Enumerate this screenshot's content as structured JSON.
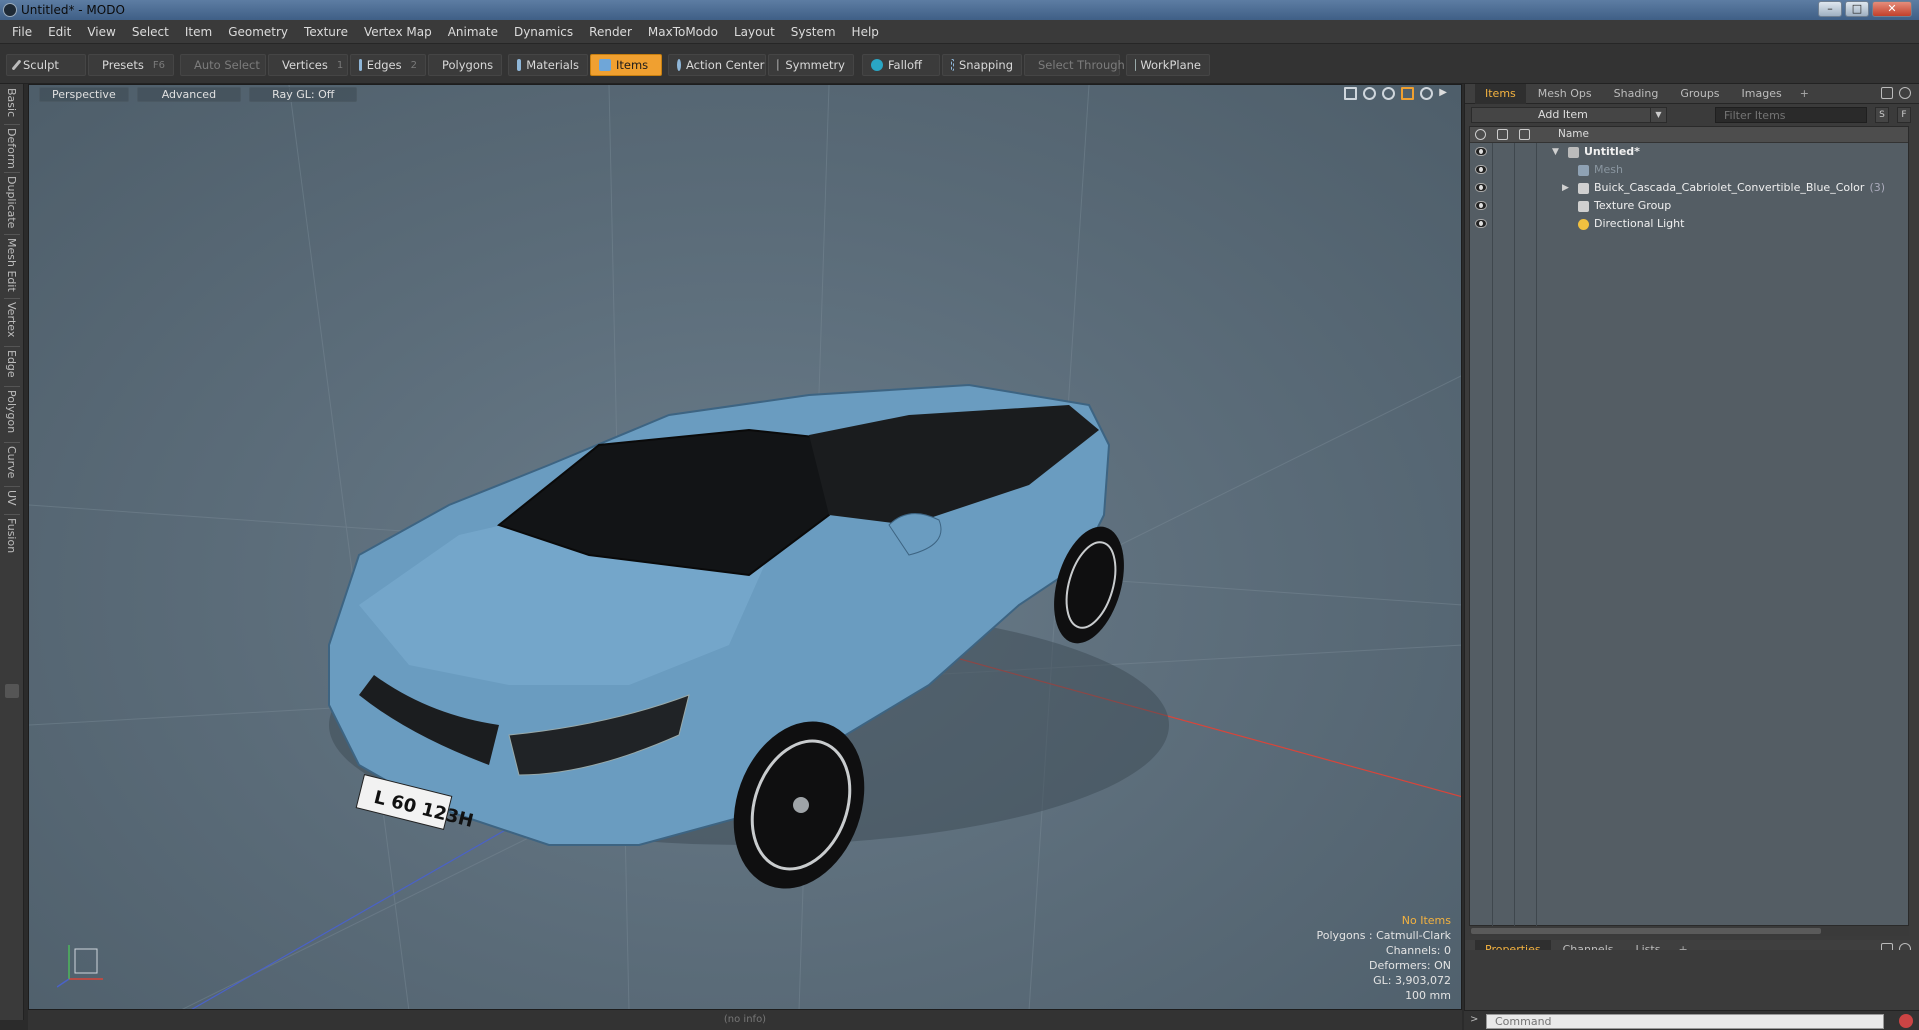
{
  "window": {
    "title": "Untitled* - MODO"
  },
  "menu": [
    "File",
    "Edit",
    "View",
    "Select",
    "Item",
    "Geometry",
    "Texture",
    "Vertex Map",
    "Animate",
    "Dynamics",
    "Render",
    "MaxToModo",
    "Layout",
    "System",
    "Help"
  ],
  "toolbar": {
    "sculpt": "Sculpt",
    "presets": "Presets",
    "presets_key": "F6",
    "auto_select": "Auto Select",
    "vertices": "Vertices",
    "vertices_key": "1",
    "edges": "Edges",
    "edges_key": "2",
    "polygons": "Polygons",
    "materials": "Materials",
    "items": "Items",
    "action_center": "Action Center",
    "symmetry": "Symmetry",
    "falloff": "Falloff",
    "snapping": "Snapping",
    "select_through": "Select Through",
    "workplane": "WorkPlane"
  },
  "left_tabs": [
    "Basic",
    "Deform",
    "Duplicate",
    "Mesh Edit",
    "Vertex",
    "Edge",
    "Polygon",
    "Curve",
    "UV",
    "Fusion"
  ],
  "viewport": {
    "view_mode": "Perspective",
    "shading": "Advanced",
    "raygl": "Ray GL: Off",
    "plate": "L 60 123H",
    "info": {
      "no_items": "No Items",
      "polygons": "Polygons : Catmull-Clark",
      "channels": "Channels: 0",
      "deformers": "Deformers: ON",
      "gl": "GL: 3,903,072",
      "size": "100 mm"
    },
    "status": "(no info)",
    "colors": {
      "car_body": "#6a9cc0",
      "grid_red": "#d8453a",
      "grid_blue": "#4a62c8",
      "accent": "#f0a030"
    }
  },
  "panel": {
    "tabs": [
      "Items",
      "Mesh Ops",
      "Shading",
      "Groups",
      "Images"
    ],
    "add_item": "Add Item",
    "filter_placeholder": "Filter Items",
    "s_btn": "S",
    "f_btn": "F",
    "name_col": "Name",
    "items": [
      {
        "label": "Untitled*",
        "icon": "scene-icon"
      },
      {
        "label": "Mesh",
        "icon": "mesh-icon"
      },
      {
        "label": "Buick_Cascada_Cabriolet_Convertible_Blue_Color",
        "count": "(3)",
        "icon": "locator-icon"
      },
      {
        "label": "Texture Group",
        "icon": "texture-group-icon"
      },
      {
        "label": "Directional Light",
        "icon": "light-icon"
      }
    ],
    "bottom_tabs": [
      "Properties",
      "Channels",
      "Lists"
    ],
    "command_placeholder": "Command"
  }
}
